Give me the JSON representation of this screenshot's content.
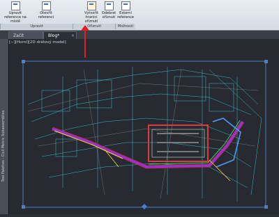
{
  "ribbon": {
    "buttons": [
      {
        "label": "Upravit reference na místě"
      },
      {
        "label": "Otevřít referenci"
      },
      {
        "label": "Vytvořit hranici oříznutí"
      },
      {
        "label": "Odebrat oříznutí"
      },
      {
        "label": "Externí reference"
      }
    ],
    "groups": [
      "Upravit",
      "Oříznutí",
      "Možnosti"
    ]
  },
  "tabs": [
    {
      "label": "Začít"
    },
    {
      "label": "Blog*"
    }
  ],
  "viewport": {
    "label": "[−][Horní][2D drátový model]"
  },
  "palette": {
    "label": "Tool Palettes - Civil Metric Subassemblies"
  },
  "colors": {
    "ribbon_bg": "#dfe4ea",
    "canvas_bg": "#272b31",
    "arrow": "#e02020",
    "selection_frame": "#4a7fd0"
  }
}
